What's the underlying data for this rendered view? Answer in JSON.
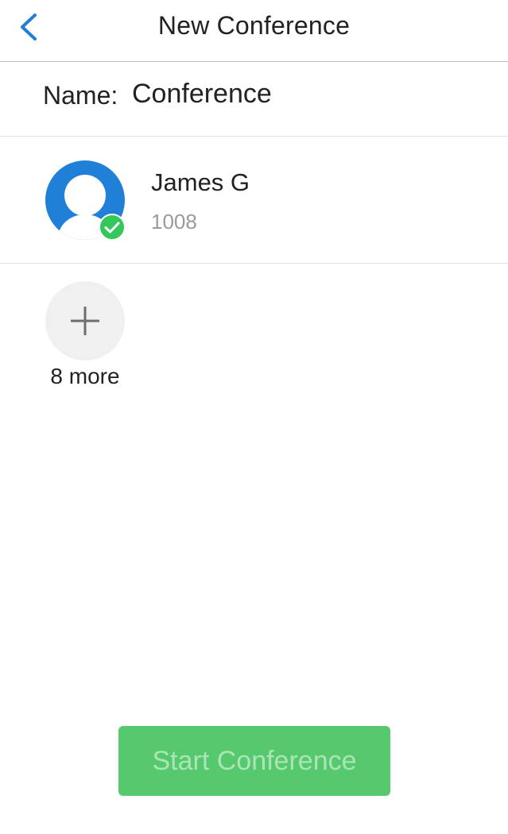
{
  "header": {
    "back_icon": "chevron-left-icon",
    "title": "New Conference"
  },
  "conference": {
    "name_label": "Name:",
    "name_value": "Conference"
  },
  "participants": [
    {
      "name": "James G",
      "extension": "1008",
      "avatar_icon": "user-avatar-icon",
      "status_icon": "checkmark-circle-icon",
      "status_color": "#34c759"
    }
  ],
  "add_more": {
    "icon": "plus-icon",
    "label": "8 more"
  },
  "start_button": {
    "label": "Start Conference",
    "color": "#56c96e"
  },
  "colors": {
    "accent": "#1f7fd6",
    "avatar_blue": "#2080d8"
  }
}
